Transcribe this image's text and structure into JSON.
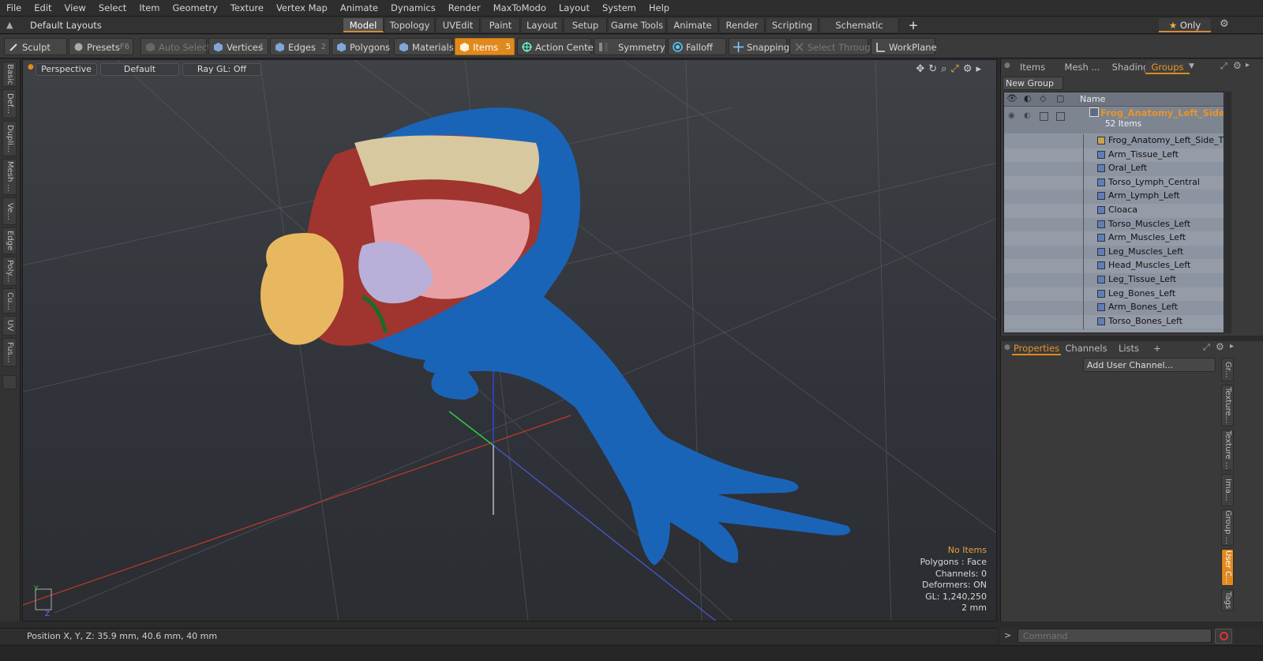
{
  "menu": [
    "File",
    "Edit",
    "View",
    "Select",
    "Item",
    "Geometry",
    "Texture",
    "Vertex Map",
    "Animate",
    "Dynamics",
    "Render",
    "MaxToModo",
    "Layout",
    "System",
    "Help"
  ],
  "layoutbar": {
    "preset": "Default Layouts",
    "tabs": [
      "Model",
      "Topology",
      "UVEdit",
      "Paint",
      "Layout",
      "Setup",
      "Game Tools",
      "Animate",
      "Render",
      "Scripting",
      "Schematic Fusion"
    ],
    "active_tab": "Model",
    "add": "+",
    "only_label": "Only"
  },
  "toolbar": {
    "sculpt": "Sculpt",
    "presets": "Presets",
    "presets_key": "F6",
    "auto_select": "Auto Select",
    "vertices": "Vertices",
    "vertices_key": "1",
    "edges": "Edges",
    "edges_key": "2",
    "polygons": "Polygons",
    "materials": "Materials",
    "items": "Items",
    "items_key": "5",
    "action_center": "Action Center",
    "symmetry": "Symmetry",
    "falloff": "Falloff",
    "snapping": "Snapping",
    "select_through": "Select Through",
    "workplane": "WorkPlane"
  },
  "left_tabs": [
    "Basic",
    "Def...",
    "Dupli...",
    "Mesh ...",
    "Ve...",
    "Edge",
    "Poly...",
    "Cu...",
    "UV",
    "Fus..."
  ],
  "viewport": {
    "view": "Perspective",
    "shading": "Default",
    "raygl": "Ray GL: Off",
    "info": {
      "selection": "No Items",
      "polygons": "Polygons : Face",
      "channels": "Channels: 0",
      "deformers": "Deformers: ON",
      "gl": "GL: 1,240,250",
      "scale": "2 mm"
    }
  },
  "status": {
    "position": "Position X, Y, Z:  35.9 mm, 40.6 mm, 40 mm"
  },
  "items_panel": {
    "tabs": [
      "Items",
      "Mesh ...",
      "Shading",
      "Groups"
    ],
    "active_tab": "Groups",
    "new_group": "New Group",
    "col_name": "Name",
    "group_name": "Frog_Anatomy_Left_Side ...",
    "group_count": "52 Items",
    "children": [
      "Frog_Anatomy_Left_Side_T...",
      "Arm_Tissue_Left",
      "Oral_Left",
      "Torso_Lymph_Central",
      "Arm_Lymph_Left",
      "Cloaca",
      "Torso_Muscles_Left",
      "Arm_Muscles_Left",
      "Leg_Muscles_Left",
      "Head_Muscles_Left",
      "Leg_Tissue_Left",
      "Leg_Bones_Left",
      "Arm_Bones_Left",
      "Torso_Bones_Left"
    ]
  },
  "properties_panel": {
    "tabs": [
      "Properties",
      "Channels",
      "Lists"
    ],
    "active_tab": "Properties",
    "add": "+",
    "add_user_channel": "Add User Channel...",
    "side_tabs": [
      "Gr...",
      "Texture...",
      "Texture ...",
      "Ima...",
      "Group ...",
      "User C...",
      "Tags"
    ],
    "active_side_tab": "User C..."
  },
  "command": {
    "prompt": ">",
    "placeholder": "Command"
  },
  "colors": {
    "accent": "#e08a1e",
    "frog_skin": "#1a64b8",
    "list_bg": "#8e96a3"
  }
}
